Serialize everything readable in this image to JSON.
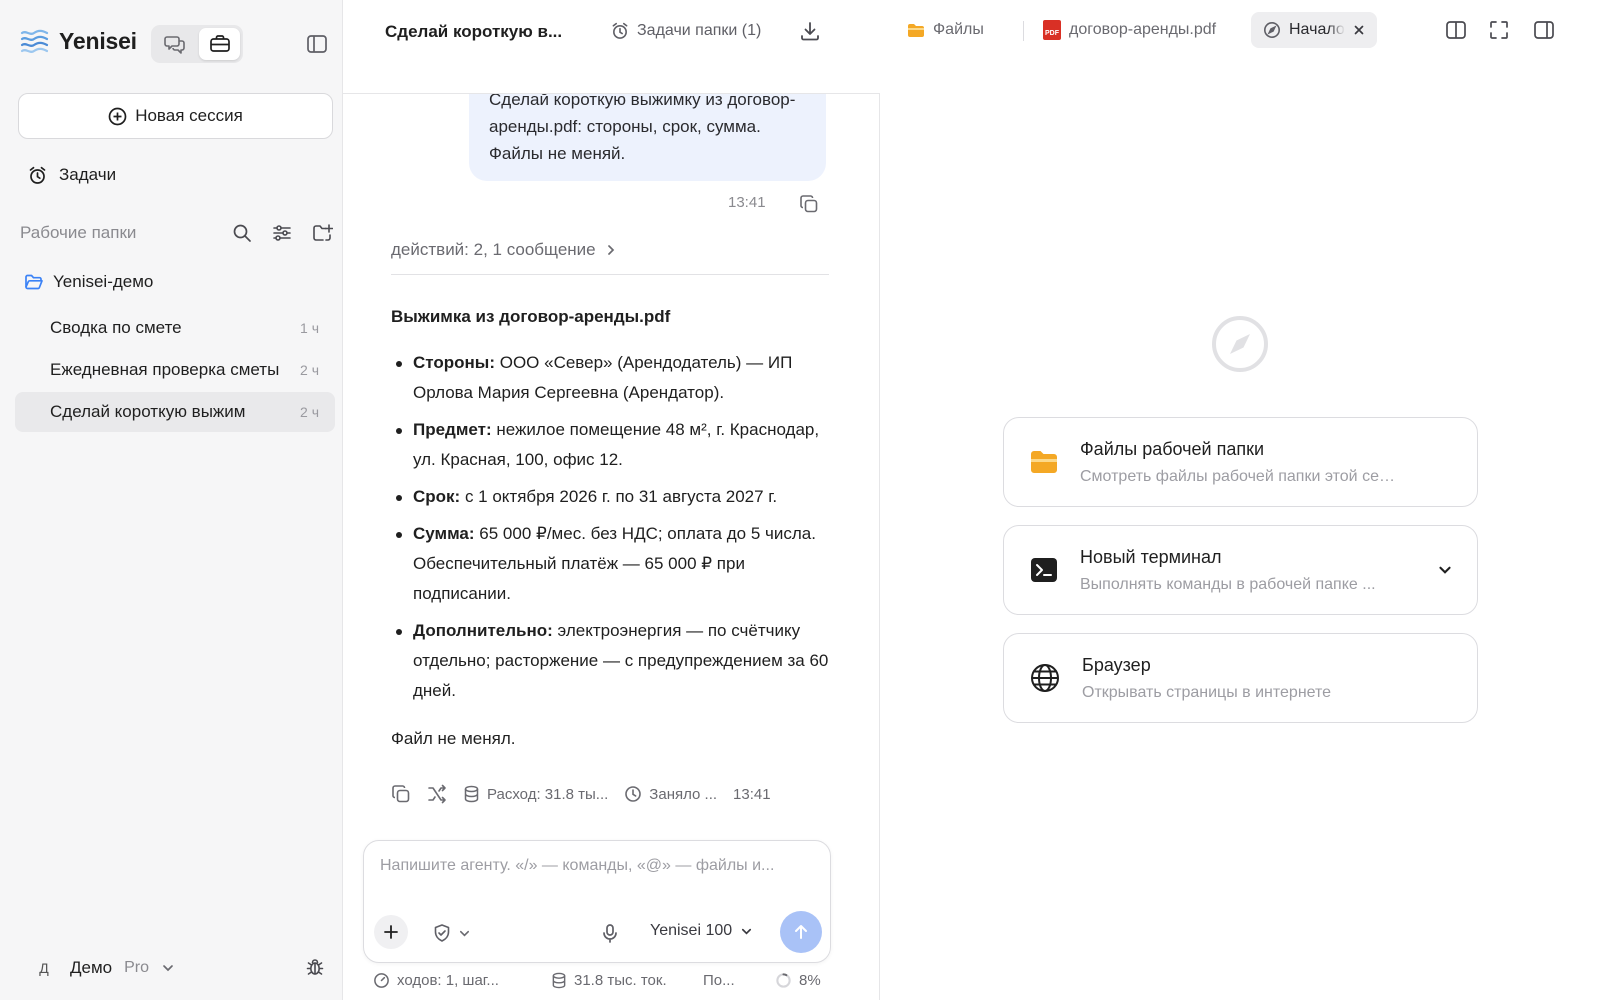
{
  "app": {
    "name": "Yenisei"
  },
  "sidebar": {
    "new_session_label": "Новая сессия",
    "tasks_label": "Задачи",
    "folders_section_label": "Рабочие папки",
    "folder": {
      "name": "Yenisei-демо"
    },
    "sessions": [
      {
        "title": "Сводка по смете",
        "age": "1 ч",
        "active": false
      },
      {
        "title": "Ежедневная проверка сметы",
        "age": "2 ч",
        "active": false
      },
      {
        "title": "Сделай короткую выжим",
        "age": "2 ч",
        "active": true
      }
    ],
    "user": {
      "initial": "Д",
      "name": "Демо",
      "plan": "Pro"
    }
  },
  "chat": {
    "title": "Сделай короткую в...",
    "folder_tasks_label": "Задачи папки (1)",
    "user_message": "Сделай короткую выжимку из договор-аренды.pdf: стороны, срок, сумма. Файлы не меняй.",
    "user_message_time": "13:41",
    "actions_summary": "действий: 2, 1 сообщение",
    "answer": {
      "heading": "Выжимка из договор-аренды.pdf",
      "items": [
        {
          "label": "Стороны:",
          "text": "ООО «Север» (Арендодатель) — ИП Орлова Мария Сергеевна (Арендатор)."
        },
        {
          "label": "Предмет:",
          "text": "нежилое помещение 48 м², г. Краснодар, ул. Красная, 100, офис 12."
        },
        {
          "label": "Срок:",
          "text": "с 1 октября 2026 г. по 31 августа 2027 г."
        },
        {
          "label": "Сумма:",
          "text": "65 000 ₽/мес. без НДС; оплата до 5 числа. Обеспечительный платёж — 65 000 ₽ при подписании."
        },
        {
          "label": "Дополнительно:",
          "text": "электроэнергия — по счётчику отдельно; расторжение — с предупреждением за 60 дней."
        }
      ],
      "final": "Файл не менял."
    },
    "meta": {
      "cost": "Расход: 31.8 ты...",
      "duration": "Заняло ...",
      "time": "13:41"
    },
    "composer": {
      "placeholder": "Напишите агенту. «/» — команды, «@» — файлы и...",
      "model": "Yenisei 100"
    },
    "status": {
      "steps": "ходов: 1, шаг...",
      "tokens": "31.8 тыс. ток.",
      "more": "По...",
      "context": "8%"
    }
  },
  "panel": {
    "tabs": [
      {
        "label": "Файлы"
      },
      {
        "label": "договор-аренды.pdf",
        "badge": "PDF"
      },
      {
        "label": "Начало"
      }
    ],
    "cards": [
      {
        "title": "Файлы рабочей папки",
        "subtitle": "Смотреть файлы рабочей папки этой сессии"
      },
      {
        "title": "Новый терминал",
        "subtitle": "Выполнять команды в рабочей папке ..."
      },
      {
        "title": "Браузер",
        "subtitle": "Открывать страницы в интернете"
      }
    ]
  },
  "colors": {
    "accent": "#3b82f6",
    "send_disabled": "#a9c2f7",
    "folder": "#f4a825",
    "pdf": "#d93025"
  }
}
